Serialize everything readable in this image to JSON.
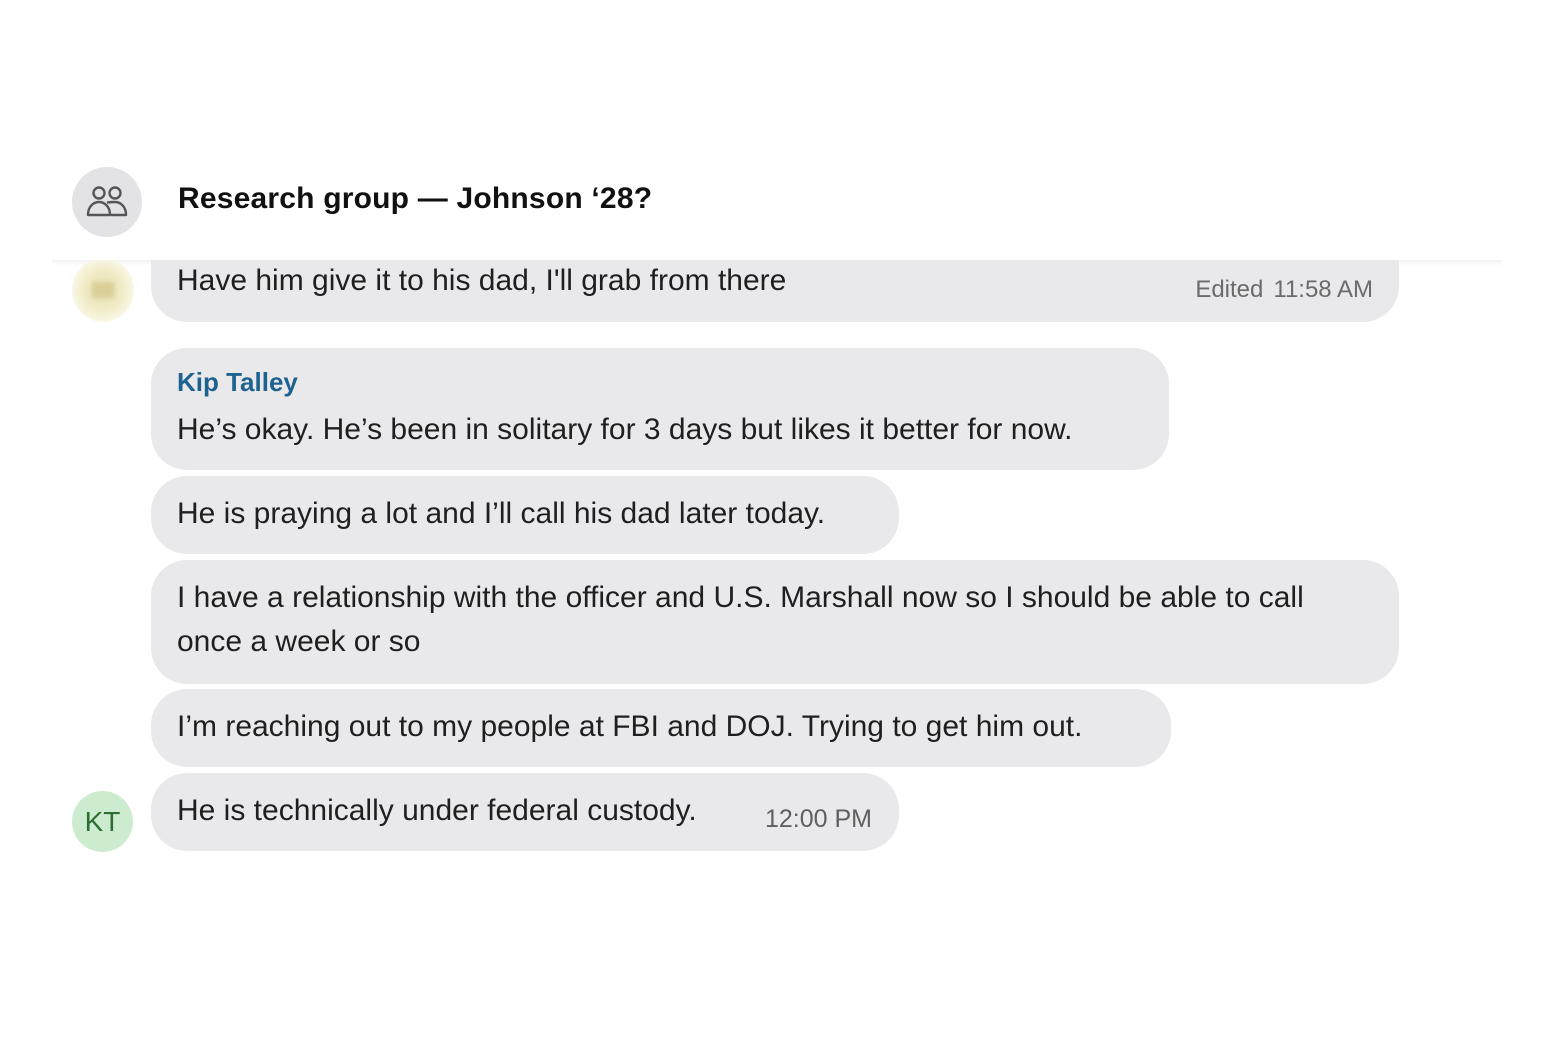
{
  "header": {
    "title": "Research group — Johnson ‘28?",
    "avatar_icon": "group-icon"
  },
  "messages": [
    {
      "text": "Have him give it to his dad, I'll grab from there",
      "edited_label": "Edited",
      "time": "11:58 AM",
      "avatar": "blurred"
    },
    {
      "sender": "Kip Talley",
      "text": "He’s okay. He’s been in solitary for 3 days but likes it better for now."
    },
    {
      "text": "He is praying a lot and I’ll call his dad later today."
    },
    {
      "text": "I have a relationship with the officer and U.S. Marshall now so I should be able to call once a week or so"
    },
    {
      "text": "I’m reaching out to my people at FBI and DOJ. Trying to get him out."
    },
    {
      "text": "He is technically under federal custody.",
      "time": "12:00 PM"
    }
  ],
  "sender_avatar": {
    "initials": "KT"
  },
  "colors": {
    "bubble": "#e9e9eb",
    "sender_name": "#1e6390",
    "avatar_kt_bg": "#cdebcf",
    "avatar_kt_text": "#2d6e33",
    "group_avatar_bg": "#e3e3e5"
  }
}
